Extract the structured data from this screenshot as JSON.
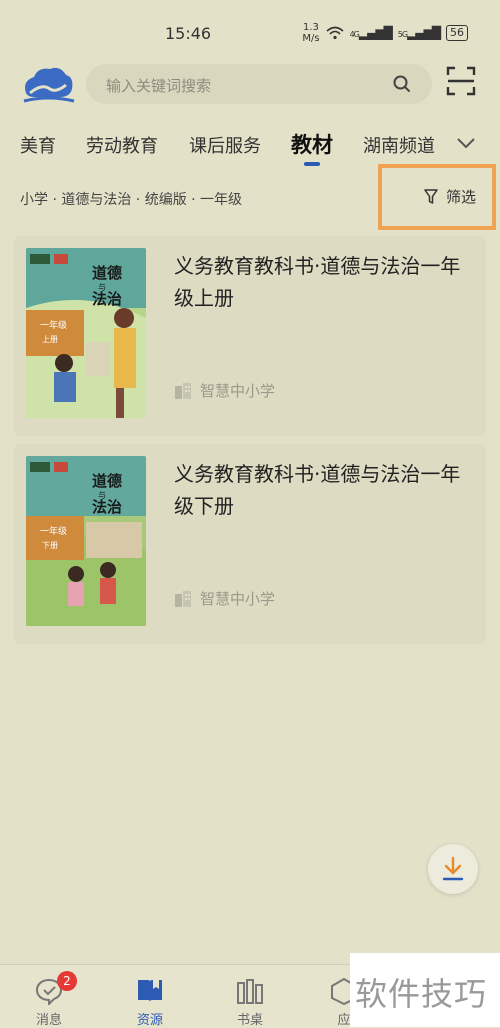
{
  "status": {
    "time": "15:46",
    "speed_value": "1.3",
    "speed_unit": "M/s",
    "network_4g": "4G",
    "network_5g": "5G",
    "battery": "56"
  },
  "search": {
    "placeholder": "输入关键词搜索"
  },
  "tabs": [
    {
      "label": "美育"
    },
    {
      "label": "劳动教育"
    },
    {
      "label": "课后服务"
    },
    {
      "label": "教材"
    },
    {
      "label": "湖南频道"
    }
  ],
  "active_tab": "教材",
  "filter": {
    "breadcrumb": "小学 · 道德与法治 · 统编版 · 一年级",
    "label": "筛选"
  },
  "books": [
    {
      "title": "义务教育教科书·道德与法治一年级上册",
      "publisher": "智慧中小学",
      "cover_title_1": "道德",
      "cover_title_2": "与",
      "cover_title_3": "法治",
      "cover_grade": "一年级",
      "cover_volume": "上册"
    },
    {
      "title": "义务教育教科书·道德与法治一年级下册",
      "publisher": "智慧中小学",
      "cover_title_1": "道德",
      "cover_title_2": "与",
      "cover_title_3": "法治",
      "cover_grade": "一年级",
      "cover_volume": "下册"
    }
  ],
  "bottom_nav": [
    {
      "label": "消息",
      "icon": "message-icon",
      "badge": "2"
    },
    {
      "label": "资源",
      "icon": "book-icon"
    },
    {
      "label": "书桌",
      "icon": "bookshelf-icon"
    },
    {
      "label": "应",
      "icon": "app-icon"
    }
  ],
  "watermark": "软件技巧",
  "colors": {
    "background": "#e3e1c8",
    "accent": "#2d5bb4",
    "highlight": "#f0a251",
    "download": "#e88a2a",
    "badge": "#e53935"
  }
}
